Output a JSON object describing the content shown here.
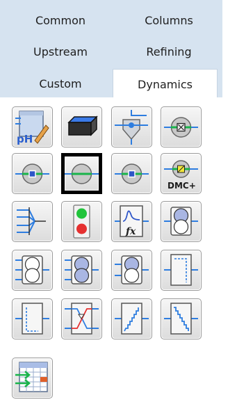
{
  "tabs": [
    {
      "label": "Common"
    },
    {
      "label": "Columns"
    },
    {
      "label": "Upstream"
    },
    {
      "label": "Refining"
    },
    {
      "label": "Custom"
    },
    {
      "label": "Dynamics",
      "active": true
    }
  ],
  "palette": {
    "active_tab": "Dynamics",
    "items": [
      {
        "icon": "ph-controller-icon",
        "label": "pH"
      },
      {
        "icon": "surge-tank-icon"
      },
      {
        "icon": "separator-vessel-icon"
      },
      {
        "icon": "valve-controller-icon"
      },
      {
        "icon": "pid-controller-icon"
      },
      {
        "icon": "split-range-controller-icon",
        "selected": true
      },
      {
        "icon": "controller-blue-icon"
      },
      {
        "icon": "dmc-controller-icon",
        "label": "DMC+"
      },
      {
        "icon": "selector-block-icon"
      },
      {
        "icon": "traffic-light-icon"
      },
      {
        "icon": "transfer-function-icon",
        "label": "fx"
      },
      {
        "icon": "ratio-controller-icon"
      },
      {
        "icon": "mpc-controller-icon"
      },
      {
        "icon": "feedforward-controller-icon"
      },
      {
        "icon": "cascade-controller-icon"
      },
      {
        "icon": "dead-time-block-icon"
      },
      {
        "icon": "lead-lag-block-icon"
      },
      {
        "icon": "crossover-block-icon"
      },
      {
        "icon": "ramp-up-icon"
      },
      {
        "icon": "ramp-down-icon"
      },
      {
        "icon": "spreadsheet-icon"
      }
    ]
  }
}
